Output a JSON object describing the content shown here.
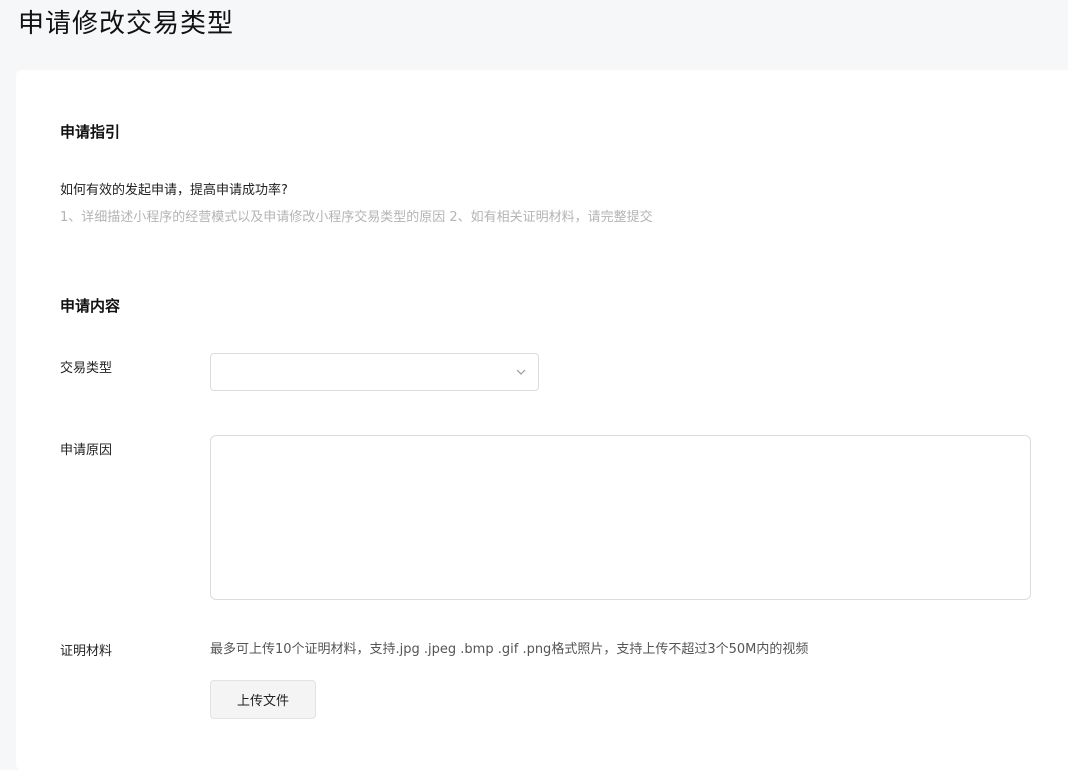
{
  "page": {
    "title": "申请修改交易类型"
  },
  "guide": {
    "section_title": "申请指引",
    "question": "如何有效的发起申请，提高申请成功率?",
    "description": "1、详细描述小程序的经营模式以及申请修改小程序交易类型的原因 2、如有相关证明材料，请完整提交"
  },
  "form": {
    "section_title": "申请内容",
    "trade_type": {
      "label": "交易类型",
      "value": "",
      "icon": "chevron-down-icon"
    },
    "reason": {
      "label": "申请原因",
      "value": "",
      "placeholder": ""
    },
    "proof": {
      "label": "证明材料",
      "hint": "最多可上传10个证明材料，支持.jpg .jpeg .bmp .gif .png格式照片，支持上传不超过3个50M内的视频",
      "upload_button": "上传文件"
    }
  }
}
